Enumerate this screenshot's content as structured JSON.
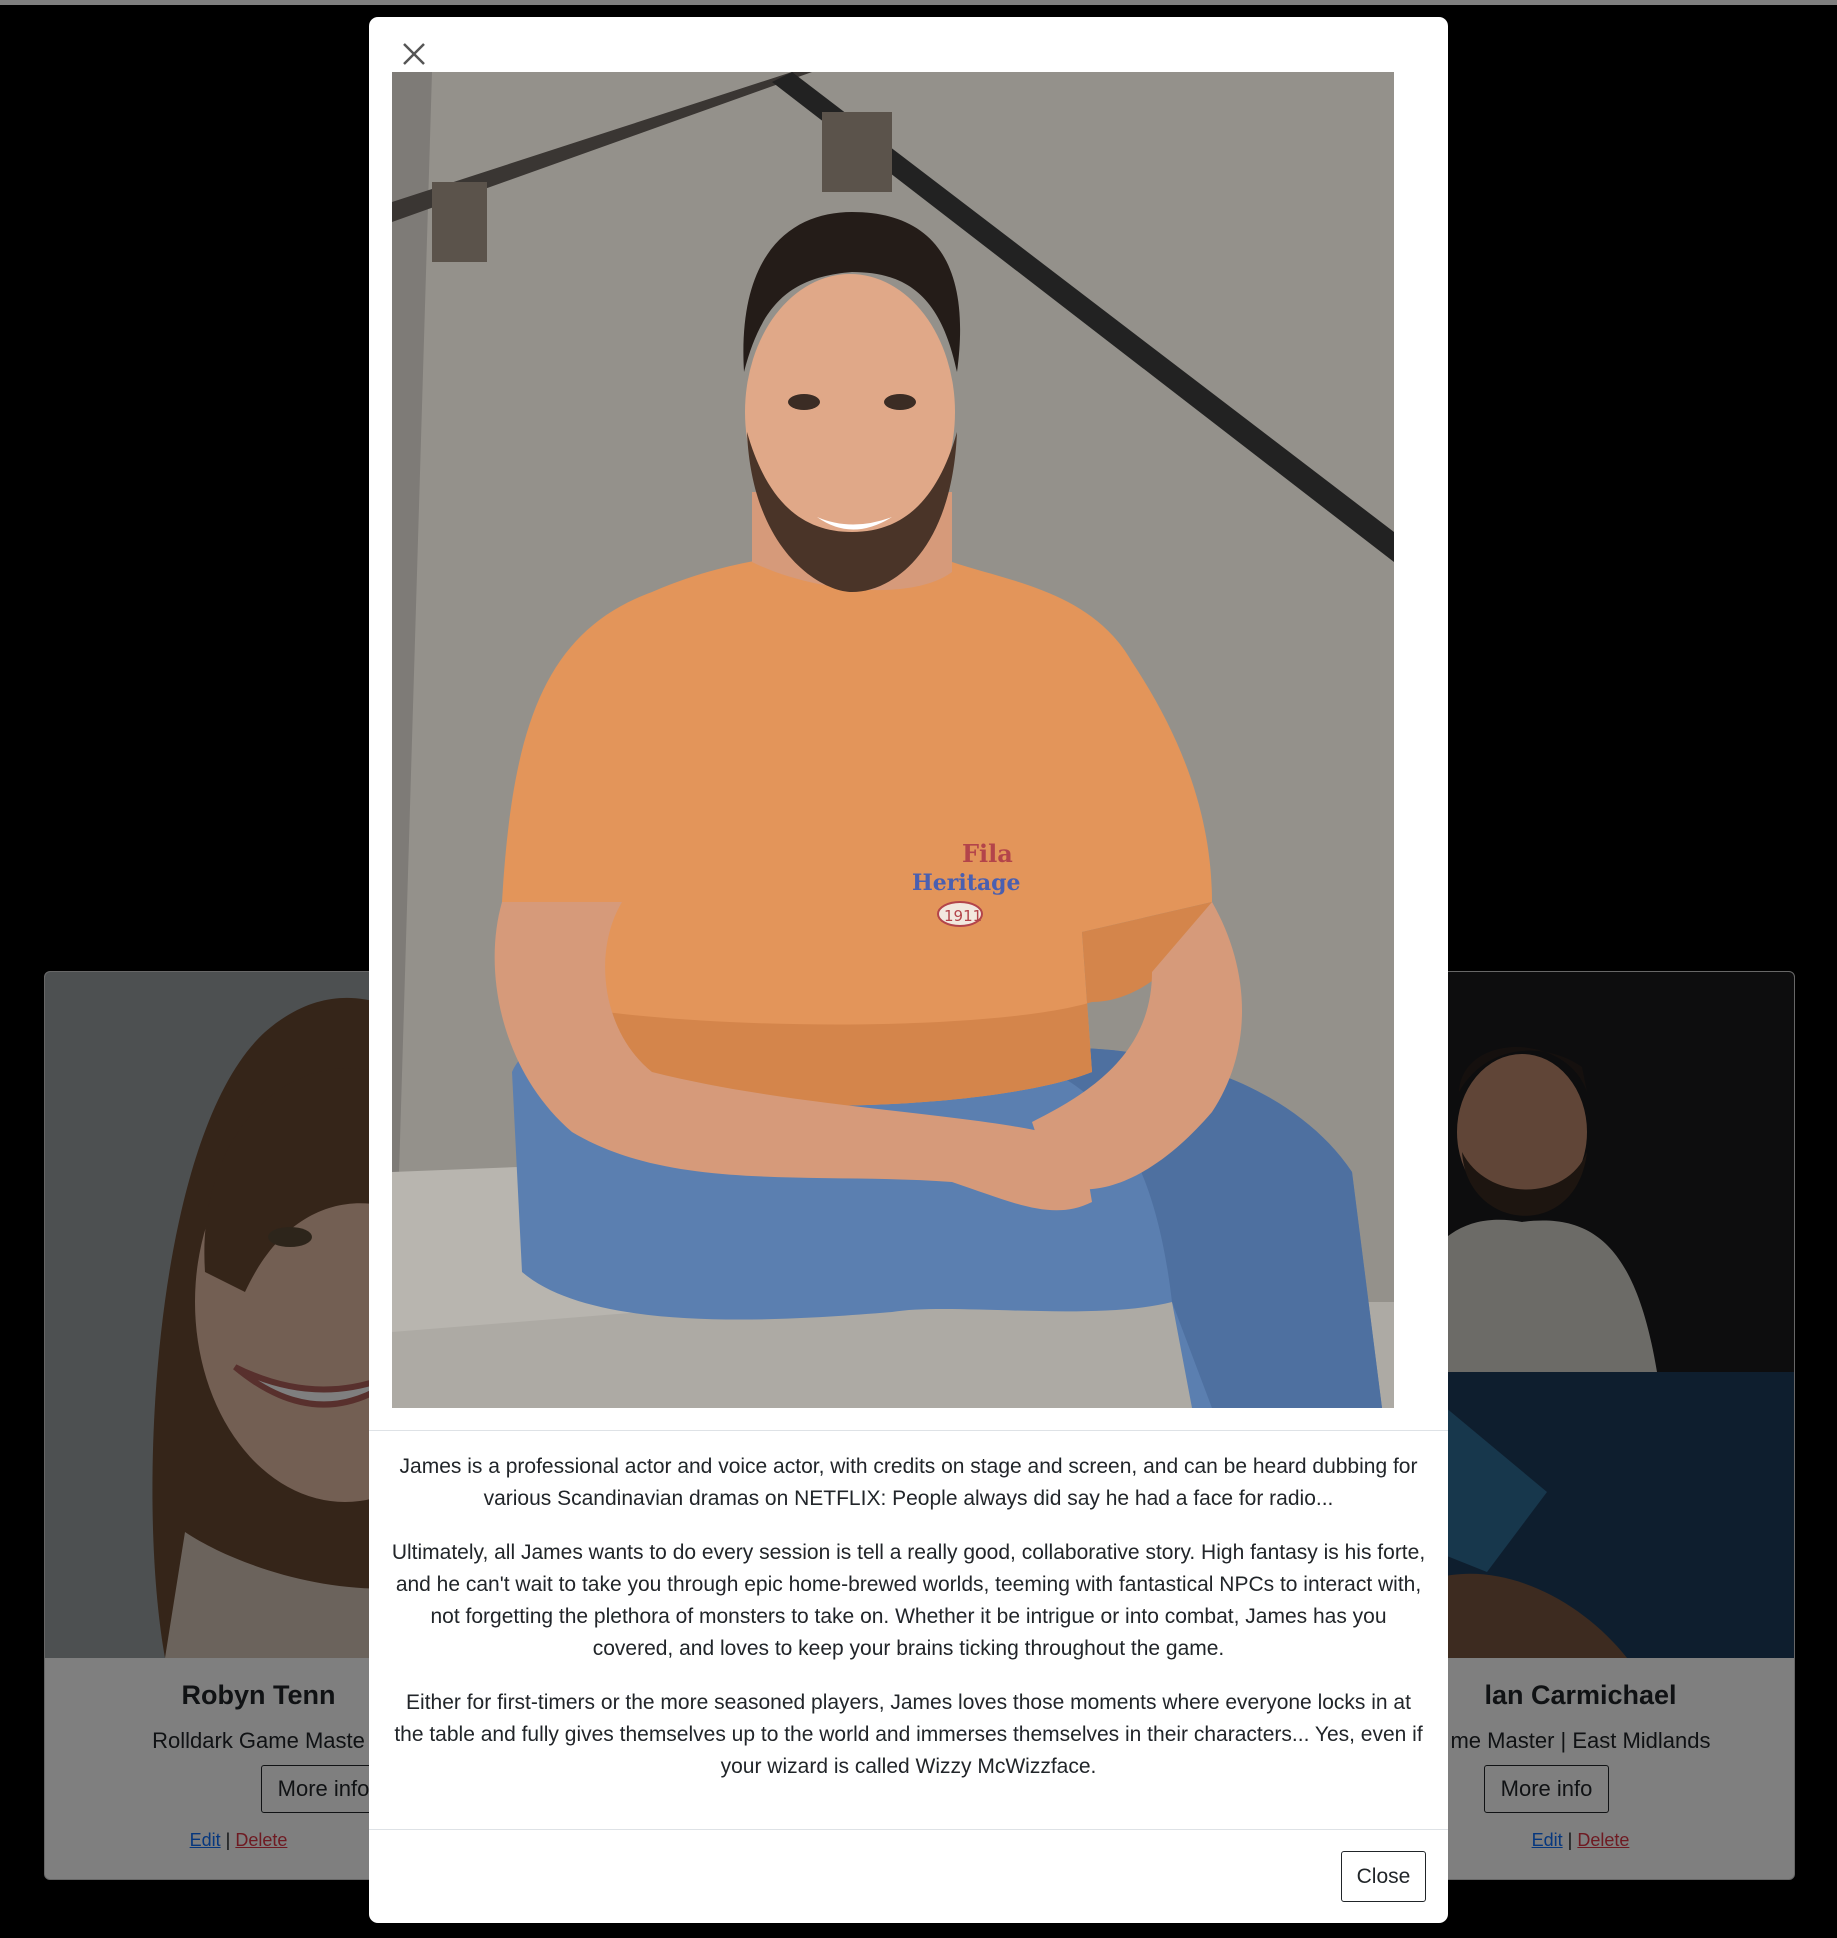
{
  "cards": [
    {
      "name": "Robyn Tenn",
      "role": "Rolldark Game Maste",
      "more_label": "More info",
      "edit_label": "Edit",
      "separator": "|",
      "delete_label": "Delete"
    },
    {
      "name": "lan Carmichael",
      "role": "me Master | East Midlands",
      "more_label": "More info",
      "edit_label": "Edit",
      "separator": "|",
      "delete_label": "Delete"
    }
  ],
  "modal": {
    "bio": [
      "James is a professional actor and voice actor, with credits on stage and screen, and can be heard dubbing for various Scandinavian dramas on NETFLIX: People always did say he had a face for radio...",
      "Ultimately, all James wants to do every session is tell a really good, collaborative story. High fantasy is his forte, and he can't wait to take you through epic home-brewed worlds, teeming with fantastical NPCs to interact with, not forgetting the plethora of monsters to take on. Whether it be intrigue or into combat, James has you covered, and loves to keep your brains ticking throughout the game.",
      "Either for first-timers or the more seasoned players, James loves those moments where everyone locks in at the table and fully gives themselves up to the world and immerses themselves in their characters... Yes, even if your wizard is called Wizzy McWizzface."
    ],
    "close_label": "Close",
    "photo_shirt_text": [
      "Fila",
      "Heritage",
      "1911"
    ]
  },
  "colors": {
    "link": "#0d6efd",
    "danger": "#dc3545",
    "shirt": "#e3955a",
    "jeans": "#5b7fb0"
  }
}
